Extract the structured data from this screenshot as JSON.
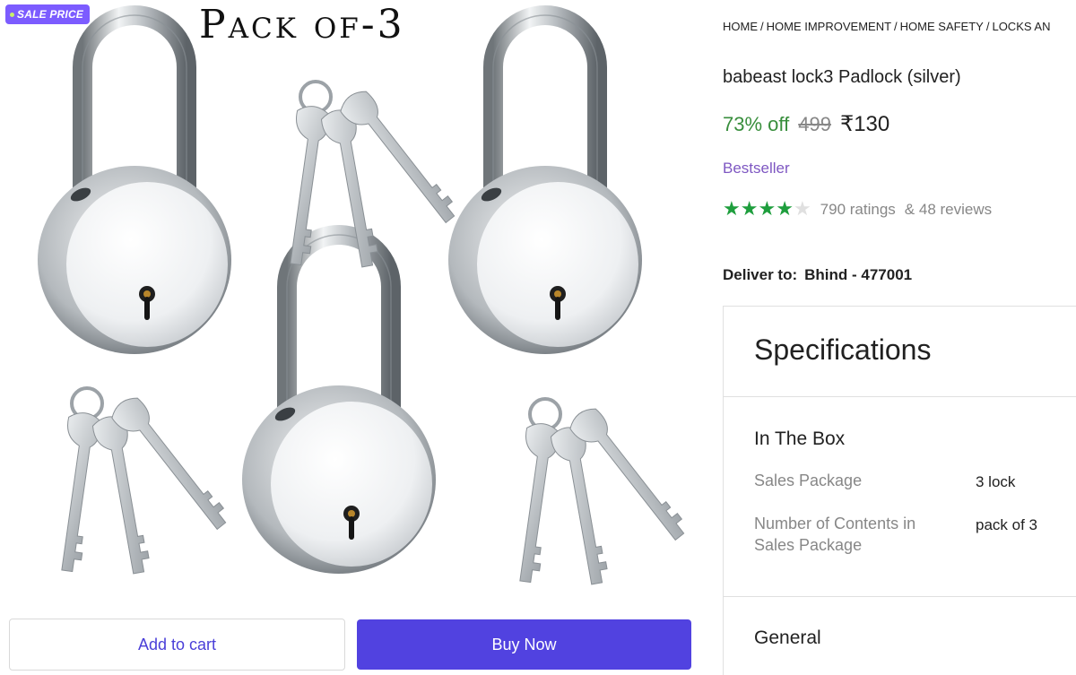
{
  "badge": {
    "label": "SALE PRICE"
  },
  "banner": {
    "title": "Pack of-3"
  },
  "breadcrumb": [
    "HOME",
    "HOME IMPROVEMENT",
    "HOME SAFETY",
    "LOCKS AN"
  ],
  "product": {
    "title": "babeast lock3 Padlock (silver)",
    "discount": "73% off",
    "mrp": "499",
    "price": "₹130",
    "tag": "Bestseller",
    "rating_value": 4,
    "rating_max": 5,
    "ratings_text": "790 ratings",
    "reviews_text": "& 48 reviews"
  },
  "delivery": {
    "label": "Deliver to:",
    "location": "Bhind - 477001"
  },
  "specs": {
    "heading": "Specifications",
    "in_the_box": {
      "title": "In The Box",
      "rows": [
        {
          "label": "Sales Package",
          "value": "3 lock"
        },
        {
          "label": "Number of Contents in Sales Package",
          "value": "pack of 3"
        }
      ]
    },
    "general_title": "General"
  },
  "actions": {
    "add_to_cart": "Add to cart",
    "buy_now": "Buy Now"
  },
  "colors": {
    "brand": "#5142e0",
    "discount_green": "#388e3c",
    "star_green": "#1e9e3d",
    "bestseller_purple": "#7e57c2",
    "badge_purple": "#7c5cff"
  }
}
